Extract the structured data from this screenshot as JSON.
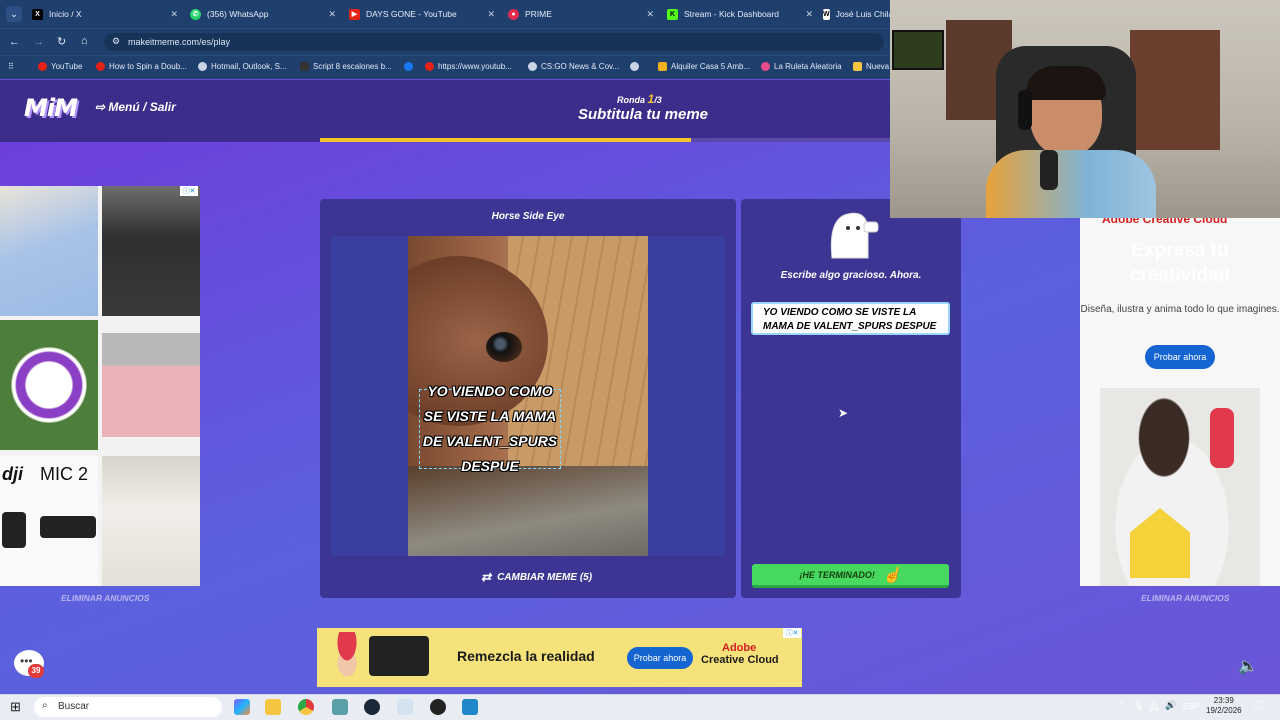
{
  "browser": {
    "tabs": [
      {
        "title": "Inicio / X",
        "icon": "x-icon"
      },
      {
        "title": "(356) WhatsApp",
        "icon": "whatsapp-icon"
      },
      {
        "title": "DAYS GONE - YouTube",
        "icon": "youtube-icon"
      },
      {
        "title": "PRIME",
        "icon": "prime-icon"
      },
      {
        "title": "Stream - Kick Dashboard",
        "icon": "kick-icon"
      },
      {
        "title": "José Luis Chila",
        "icon": "wikipedia-icon"
      }
    ],
    "url": "makeitmeme.com/es/play",
    "bookmarks": [
      "YouTube",
      "How to Spin a Doub...",
      "Hotmail, Outlook, S...",
      "Script 8 escalones b...",
      "",
      "https://www.youtub...",
      "CS:GO News & Cov...",
      "",
      "Alquiler Casa 5 Amb...",
      "La Ruleta Aleatoria",
      "Nueva"
    ]
  },
  "site": {
    "logo": "MiM",
    "menu_label": "Menú / Salir",
    "round_label": "Ronda",
    "round_current": "1",
    "round_total": "/3",
    "subtitle": "Subtitula tu meme",
    "round_progress": 0.65
  },
  "game": {
    "meme_title": "Horse Side Eye",
    "caption": "YO VIENDO COMO SE VISTE LA MAMA DE VALENT_SPURS DESPUE",
    "change_meme_label": "CAMBIAR MEME (5)",
    "prompt": "Escribe algo gracioso. Ahora.",
    "input_value": "YO VIENDO COMO SE VISTE LA MAMA DE VALENT_SPURS DESPUE",
    "finish_label": "¡HE TERMINADO!",
    "remove_ads_left": "ELIMINAR ANUNCIOS",
    "remove_ads_right": "ELIMINAR ANUNCIOS",
    "chat_badge": "39"
  },
  "ads": {
    "left_brand_text": "MIC 2",
    "right_brand": "Adobe Creative Cloud",
    "right_title": "Expresa tu creatividad",
    "right_subtitle": "Diseña, ilustra y anima todo lo que imagines.",
    "right_button": "Probar ahora",
    "bottom_headline": "Remezcla la realidad",
    "bottom_button": "Probar ahora",
    "bottom_brand_line1": "Adobe",
    "bottom_brand_line2": "Creative Cloud"
  },
  "taskbar": {
    "search_placeholder": "Buscar",
    "language": "ESP",
    "time": "23:39",
    "date": "19/2/2026"
  },
  "colors": {
    "accent_yellow": "#f5c52a",
    "finish_green": "#47d85f",
    "panel": "#3c3594",
    "header": "#3d2d8a"
  }
}
